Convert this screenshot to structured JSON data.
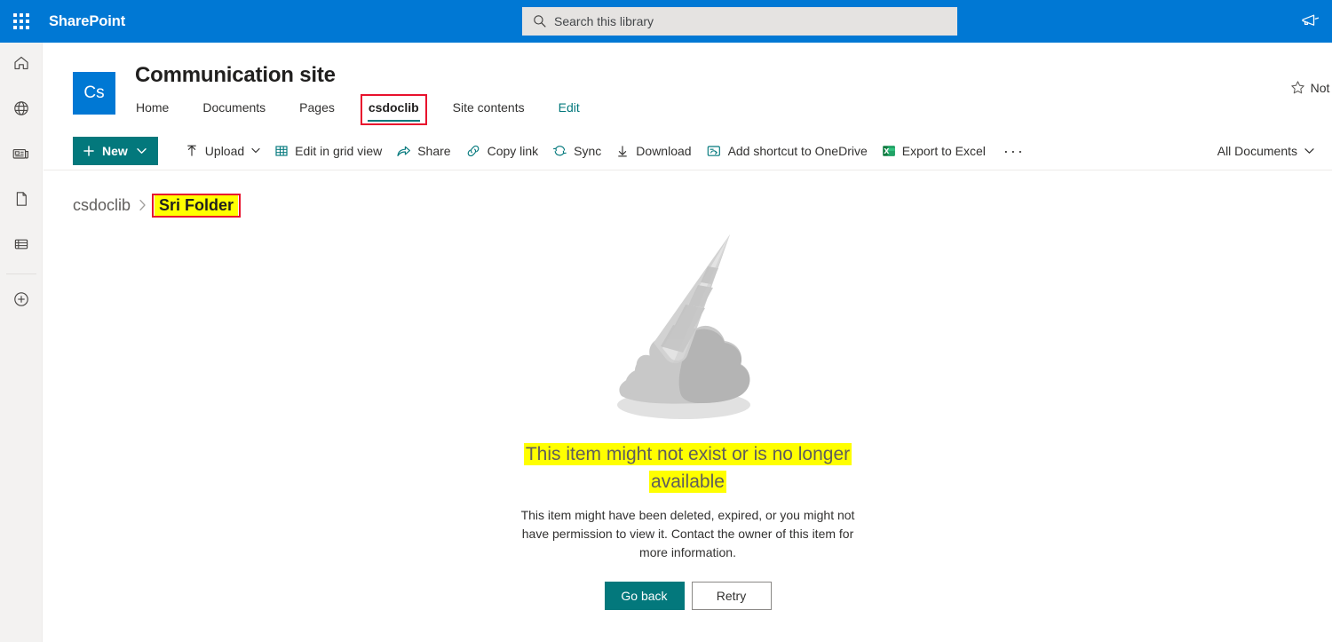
{
  "suite": {
    "brand": "SharePoint",
    "waffle_icon": "app-launcher-waffle-icon",
    "search": {
      "placeholder": "Search this library",
      "value": "",
      "icon": "search-icon"
    },
    "feedback_icon": "megaphone-feedback-icon"
  },
  "rail": {
    "items": [
      {
        "icon": "home-icon",
        "name": "home"
      },
      {
        "icon": "globe-icon",
        "name": "my-sites"
      },
      {
        "icon": "news-icon",
        "name": "news"
      },
      {
        "icon": "document-icon",
        "name": "files"
      },
      {
        "icon": "list-icon",
        "name": "lists"
      },
      {
        "icon": "plus-circle-icon",
        "name": "create"
      }
    ]
  },
  "site": {
    "logo_text": "Cs",
    "title": "Communication site",
    "nav": [
      {
        "label": "Home",
        "active": false
      },
      {
        "label": "Documents",
        "active": false
      },
      {
        "label": "Pages",
        "active": false
      },
      {
        "label": "csdoclib",
        "active": true,
        "annotated": true
      },
      {
        "label": "Site contents",
        "active": false
      },
      {
        "label": "Edit",
        "active": false,
        "style": "edit"
      }
    ],
    "follow": {
      "label": "Not fo",
      "icon": "star-outline-icon"
    }
  },
  "command_bar": {
    "new_button": {
      "label": "New",
      "plus_icon": "plus-icon",
      "chevron_icon": "chevron-down-icon"
    },
    "commands": [
      {
        "label": "Upload",
        "icon": "upload-arrow-icon",
        "has_chevron": true
      },
      {
        "label": "Edit in grid view",
        "icon": "grid-table-icon",
        "has_chevron": false
      },
      {
        "label": "Share",
        "icon": "share-icon",
        "has_chevron": false
      },
      {
        "label": "Copy link",
        "icon": "link-icon",
        "has_chevron": false
      },
      {
        "label": "Sync",
        "icon": "sync-icon",
        "has_chevron": false
      },
      {
        "label": "Download",
        "icon": "download-arrow-icon",
        "has_chevron": false
      },
      {
        "label": "Add shortcut to OneDrive",
        "icon": "onedrive-shortcut-icon",
        "has_chevron": false
      },
      {
        "label": "Export to Excel",
        "icon": "excel-icon",
        "has_chevron": false
      }
    ],
    "overflow_label": "···",
    "view": {
      "label": "All Documents",
      "chevron_icon": "chevron-down-icon"
    }
  },
  "breadcrumb": {
    "root": "csdoclib",
    "separator": "›",
    "current": "Sri Folder"
  },
  "empty_state": {
    "illustration": "dropped-ice-cream-cone-illustration",
    "title": "This item might not exist or is no longer available",
    "title_line_1": "This item might not exist or is no longer",
    "title_line_2": "available",
    "description": "This item might have been deleted, expired, or you might not have permission to view it. Contact the owner of this item for more information.",
    "primary_button": "Go back",
    "secondary_button": "Retry"
  },
  "colors": {
    "suite_blue": "#0078d4",
    "teal_accent": "#03787c",
    "highlight_yellow": "#ffff00",
    "annotation_red": "#e8112d",
    "rail_bg": "#f3f2f1"
  }
}
